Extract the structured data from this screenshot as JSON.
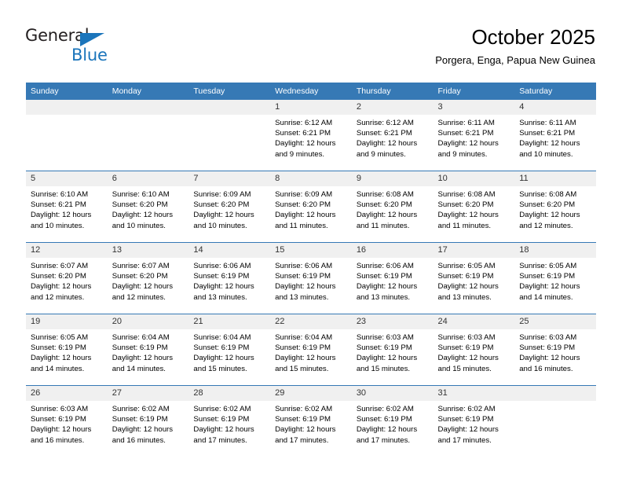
{
  "brand": {
    "name_top": "General",
    "name_bottom": "Blue",
    "accent_color": "#1b75bb"
  },
  "header": {
    "title": "October 2025",
    "subtitle": "Porgera, Enga, Papua New Guinea"
  },
  "theme": {
    "header_bg": "#3679b5",
    "daynum_bg": "#f0f0f0",
    "page_bg": "#ffffff",
    "text_color": "#000000"
  },
  "weekday_headers": [
    "Sunday",
    "Monday",
    "Tuesday",
    "Wednesday",
    "Thursday",
    "Friday",
    "Saturday"
  ],
  "weeks": [
    [
      {
        "day": "",
        "sunrise": "",
        "sunset": "",
        "daylight_line1": "",
        "daylight_line2": "",
        "empty": true
      },
      {
        "day": "",
        "sunrise": "",
        "sunset": "",
        "daylight_line1": "",
        "daylight_line2": "",
        "empty": true
      },
      {
        "day": "",
        "sunrise": "",
        "sunset": "",
        "daylight_line1": "",
        "daylight_line2": "",
        "empty": true
      },
      {
        "day": "1",
        "sunrise": "Sunrise: 6:12 AM",
        "sunset": "Sunset: 6:21 PM",
        "daylight_line1": "Daylight: 12 hours",
        "daylight_line2": "and 9 minutes."
      },
      {
        "day": "2",
        "sunrise": "Sunrise: 6:12 AM",
        "sunset": "Sunset: 6:21 PM",
        "daylight_line1": "Daylight: 12 hours",
        "daylight_line2": "and 9 minutes."
      },
      {
        "day": "3",
        "sunrise": "Sunrise: 6:11 AM",
        "sunset": "Sunset: 6:21 PM",
        "daylight_line1": "Daylight: 12 hours",
        "daylight_line2": "and 9 minutes."
      },
      {
        "day": "4",
        "sunrise": "Sunrise: 6:11 AM",
        "sunset": "Sunset: 6:21 PM",
        "daylight_line1": "Daylight: 12 hours",
        "daylight_line2": "and 10 minutes."
      }
    ],
    [
      {
        "day": "5",
        "sunrise": "Sunrise: 6:10 AM",
        "sunset": "Sunset: 6:21 PM",
        "daylight_line1": "Daylight: 12 hours",
        "daylight_line2": "and 10 minutes."
      },
      {
        "day": "6",
        "sunrise": "Sunrise: 6:10 AM",
        "sunset": "Sunset: 6:20 PM",
        "daylight_line1": "Daylight: 12 hours",
        "daylight_line2": "and 10 minutes."
      },
      {
        "day": "7",
        "sunrise": "Sunrise: 6:09 AM",
        "sunset": "Sunset: 6:20 PM",
        "daylight_line1": "Daylight: 12 hours",
        "daylight_line2": "and 10 minutes."
      },
      {
        "day": "8",
        "sunrise": "Sunrise: 6:09 AM",
        "sunset": "Sunset: 6:20 PM",
        "daylight_line1": "Daylight: 12 hours",
        "daylight_line2": "and 11 minutes."
      },
      {
        "day": "9",
        "sunrise": "Sunrise: 6:08 AM",
        "sunset": "Sunset: 6:20 PM",
        "daylight_line1": "Daylight: 12 hours",
        "daylight_line2": "and 11 minutes."
      },
      {
        "day": "10",
        "sunrise": "Sunrise: 6:08 AM",
        "sunset": "Sunset: 6:20 PM",
        "daylight_line1": "Daylight: 12 hours",
        "daylight_line2": "and 11 minutes."
      },
      {
        "day": "11",
        "sunrise": "Sunrise: 6:08 AM",
        "sunset": "Sunset: 6:20 PM",
        "daylight_line1": "Daylight: 12 hours",
        "daylight_line2": "and 12 minutes."
      }
    ],
    [
      {
        "day": "12",
        "sunrise": "Sunrise: 6:07 AM",
        "sunset": "Sunset: 6:20 PM",
        "daylight_line1": "Daylight: 12 hours",
        "daylight_line2": "and 12 minutes."
      },
      {
        "day": "13",
        "sunrise": "Sunrise: 6:07 AM",
        "sunset": "Sunset: 6:20 PM",
        "daylight_line1": "Daylight: 12 hours",
        "daylight_line2": "and 12 minutes."
      },
      {
        "day": "14",
        "sunrise": "Sunrise: 6:06 AM",
        "sunset": "Sunset: 6:19 PM",
        "daylight_line1": "Daylight: 12 hours",
        "daylight_line2": "and 13 minutes."
      },
      {
        "day": "15",
        "sunrise": "Sunrise: 6:06 AM",
        "sunset": "Sunset: 6:19 PM",
        "daylight_line1": "Daylight: 12 hours",
        "daylight_line2": "and 13 minutes."
      },
      {
        "day": "16",
        "sunrise": "Sunrise: 6:06 AM",
        "sunset": "Sunset: 6:19 PM",
        "daylight_line1": "Daylight: 12 hours",
        "daylight_line2": "and 13 minutes."
      },
      {
        "day": "17",
        "sunrise": "Sunrise: 6:05 AM",
        "sunset": "Sunset: 6:19 PM",
        "daylight_line1": "Daylight: 12 hours",
        "daylight_line2": "and 13 minutes."
      },
      {
        "day": "18",
        "sunrise": "Sunrise: 6:05 AM",
        "sunset": "Sunset: 6:19 PM",
        "daylight_line1": "Daylight: 12 hours",
        "daylight_line2": "and 14 minutes."
      }
    ],
    [
      {
        "day": "19",
        "sunrise": "Sunrise: 6:05 AM",
        "sunset": "Sunset: 6:19 PM",
        "daylight_line1": "Daylight: 12 hours",
        "daylight_line2": "and 14 minutes."
      },
      {
        "day": "20",
        "sunrise": "Sunrise: 6:04 AM",
        "sunset": "Sunset: 6:19 PM",
        "daylight_line1": "Daylight: 12 hours",
        "daylight_line2": "and 14 minutes."
      },
      {
        "day": "21",
        "sunrise": "Sunrise: 6:04 AM",
        "sunset": "Sunset: 6:19 PM",
        "daylight_line1": "Daylight: 12 hours",
        "daylight_line2": "and 15 minutes."
      },
      {
        "day": "22",
        "sunrise": "Sunrise: 6:04 AM",
        "sunset": "Sunset: 6:19 PM",
        "daylight_line1": "Daylight: 12 hours",
        "daylight_line2": "and 15 minutes."
      },
      {
        "day": "23",
        "sunrise": "Sunrise: 6:03 AM",
        "sunset": "Sunset: 6:19 PM",
        "daylight_line1": "Daylight: 12 hours",
        "daylight_line2": "and 15 minutes."
      },
      {
        "day": "24",
        "sunrise": "Sunrise: 6:03 AM",
        "sunset": "Sunset: 6:19 PM",
        "daylight_line1": "Daylight: 12 hours",
        "daylight_line2": "and 15 minutes."
      },
      {
        "day": "25",
        "sunrise": "Sunrise: 6:03 AM",
        "sunset": "Sunset: 6:19 PM",
        "daylight_line1": "Daylight: 12 hours",
        "daylight_line2": "and 16 minutes."
      }
    ],
    [
      {
        "day": "26",
        "sunrise": "Sunrise: 6:03 AM",
        "sunset": "Sunset: 6:19 PM",
        "daylight_line1": "Daylight: 12 hours",
        "daylight_line2": "and 16 minutes."
      },
      {
        "day": "27",
        "sunrise": "Sunrise: 6:02 AM",
        "sunset": "Sunset: 6:19 PM",
        "daylight_line1": "Daylight: 12 hours",
        "daylight_line2": "and 16 minutes."
      },
      {
        "day": "28",
        "sunrise": "Sunrise: 6:02 AM",
        "sunset": "Sunset: 6:19 PM",
        "daylight_line1": "Daylight: 12 hours",
        "daylight_line2": "and 17 minutes."
      },
      {
        "day": "29",
        "sunrise": "Sunrise: 6:02 AM",
        "sunset": "Sunset: 6:19 PM",
        "daylight_line1": "Daylight: 12 hours",
        "daylight_line2": "and 17 minutes."
      },
      {
        "day": "30",
        "sunrise": "Sunrise: 6:02 AM",
        "sunset": "Sunset: 6:19 PM",
        "daylight_line1": "Daylight: 12 hours",
        "daylight_line2": "and 17 minutes."
      },
      {
        "day": "31",
        "sunrise": "Sunrise: 6:02 AM",
        "sunset": "Sunset: 6:19 PM",
        "daylight_line1": "Daylight: 12 hours",
        "daylight_line2": "and 17 minutes."
      },
      {
        "day": "",
        "sunrise": "",
        "sunset": "",
        "daylight_line1": "",
        "daylight_line2": "",
        "empty": true
      }
    ]
  ]
}
